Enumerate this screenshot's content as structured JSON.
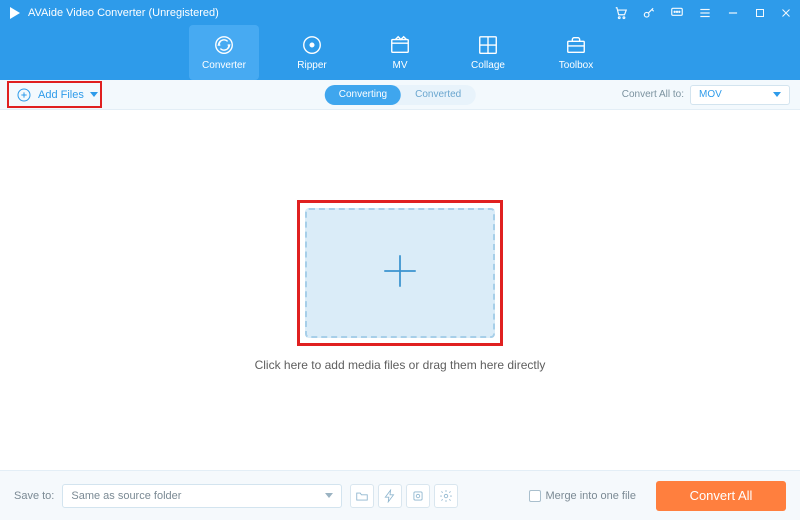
{
  "window": {
    "title": "AVAide Video Converter (Unregistered)"
  },
  "nav": {
    "items": [
      {
        "label": "Converter"
      },
      {
        "label": "Ripper"
      },
      {
        "label": "MV"
      },
      {
        "label": "Collage"
      },
      {
        "label": "Toolbox"
      }
    ]
  },
  "subbar": {
    "add_files": "Add Files",
    "converting": "Converting",
    "converted": "Converted",
    "convert_all_to": "Convert All to:",
    "format": "MOV"
  },
  "main": {
    "drop_text": "Click here to add media files or drag them here directly"
  },
  "bottom": {
    "save_to_label": "Save to:",
    "save_to_value": "Same as source folder",
    "merge_label": "Merge into one file",
    "convert_all": "Convert All"
  }
}
